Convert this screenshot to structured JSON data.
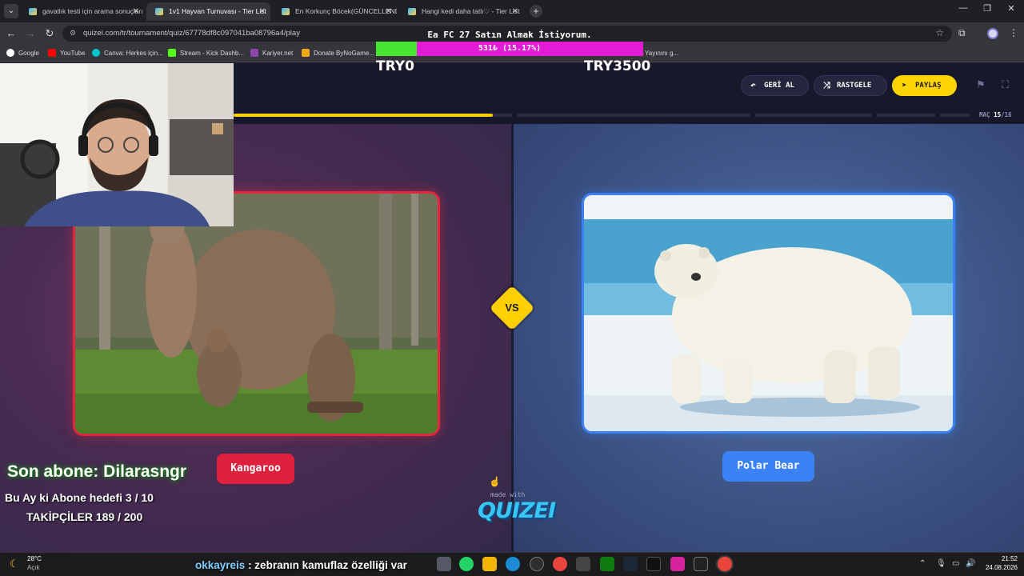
{
  "browser": {
    "tabs": [
      {
        "title": "gavatlık testi için arama sonuçları"
      },
      {
        "title": "1v1 Hayvan Turnuvası - Tier List"
      },
      {
        "title": "En Korkunç Böcek(GÜNCELLENDİ)"
      },
      {
        "title": "Hangi kedi daha tatlı♡ - Tier List"
      }
    ],
    "url": "quizei.com/tr/tournament/quiz/67778df8c097041ba08796a4/play",
    "bookmarks": [
      "Google",
      "YouTube",
      "Canva: Herkes için...",
      "Stream - Kick Dashb...",
      "Kariyer.net",
      "Donate ByNoGame...",
      "Yayınını g..."
    ]
  },
  "donation_overlay": {
    "title": "Ea FC 27 Satın Almak İstiyorum.",
    "progress_text": "531₺ (15.17%)",
    "progress_fraction": 0.1517,
    "min_label": "TRY0",
    "max_label": "TRY3500"
  },
  "quiz": {
    "undo_label": "GERİ AL",
    "random_label": "RASTGELE",
    "share_label": "PAYLAŞ",
    "match_label": "MAÇ",
    "match_current": "15",
    "match_total": "/16",
    "progress_segments": [
      0.93,
      0,
      0,
      0,
      0
    ],
    "vs_label": "VS",
    "left_choice": "Kangaroo",
    "right_choice": "Polar Bear",
    "made_with": "made with",
    "brand": "QUIZEI",
    "accent_left": "#e0213d",
    "accent_right": "#3b82f6",
    "accent_yellow": "#ffd000"
  },
  "stream_overlay": {
    "last_sub": "Son abone: Dilarasngr",
    "monthly_goal": "Bu Ay ki Abone hedefi 3 / 10",
    "followers": "TAKİPÇİLER 189 / 200"
  },
  "chat_message": {
    "user": "okkayreis",
    "text": " : zebranın kamuflaz özelliği var"
  },
  "taskbar": {
    "temperature": "28°C",
    "condition": "Açık",
    "time": "21:52",
    "date": "24.08.2026"
  }
}
